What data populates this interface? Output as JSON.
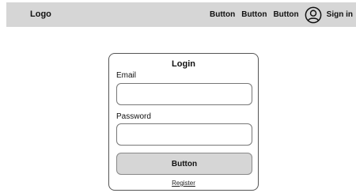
{
  "header": {
    "logo": "Logo",
    "nav_buttons": [
      "Button",
      "Button",
      "Button"
    ],
    "user_icon": "user-circle-icon",
    "sign_in": "Sign in"
  },
  "login": {
    "title": "Login",
    "email_label": "Email",
    "email_value": "",
    "password_label": "Password",
    "password_value": "",
    "submit_label": "Button",
    "register_link": "Register"
  },
  "colors": {
    "header_bg": "#d6d6d6",
    "button_bg": "#d6d6d6",
    "border": "#555555"
  }
}
